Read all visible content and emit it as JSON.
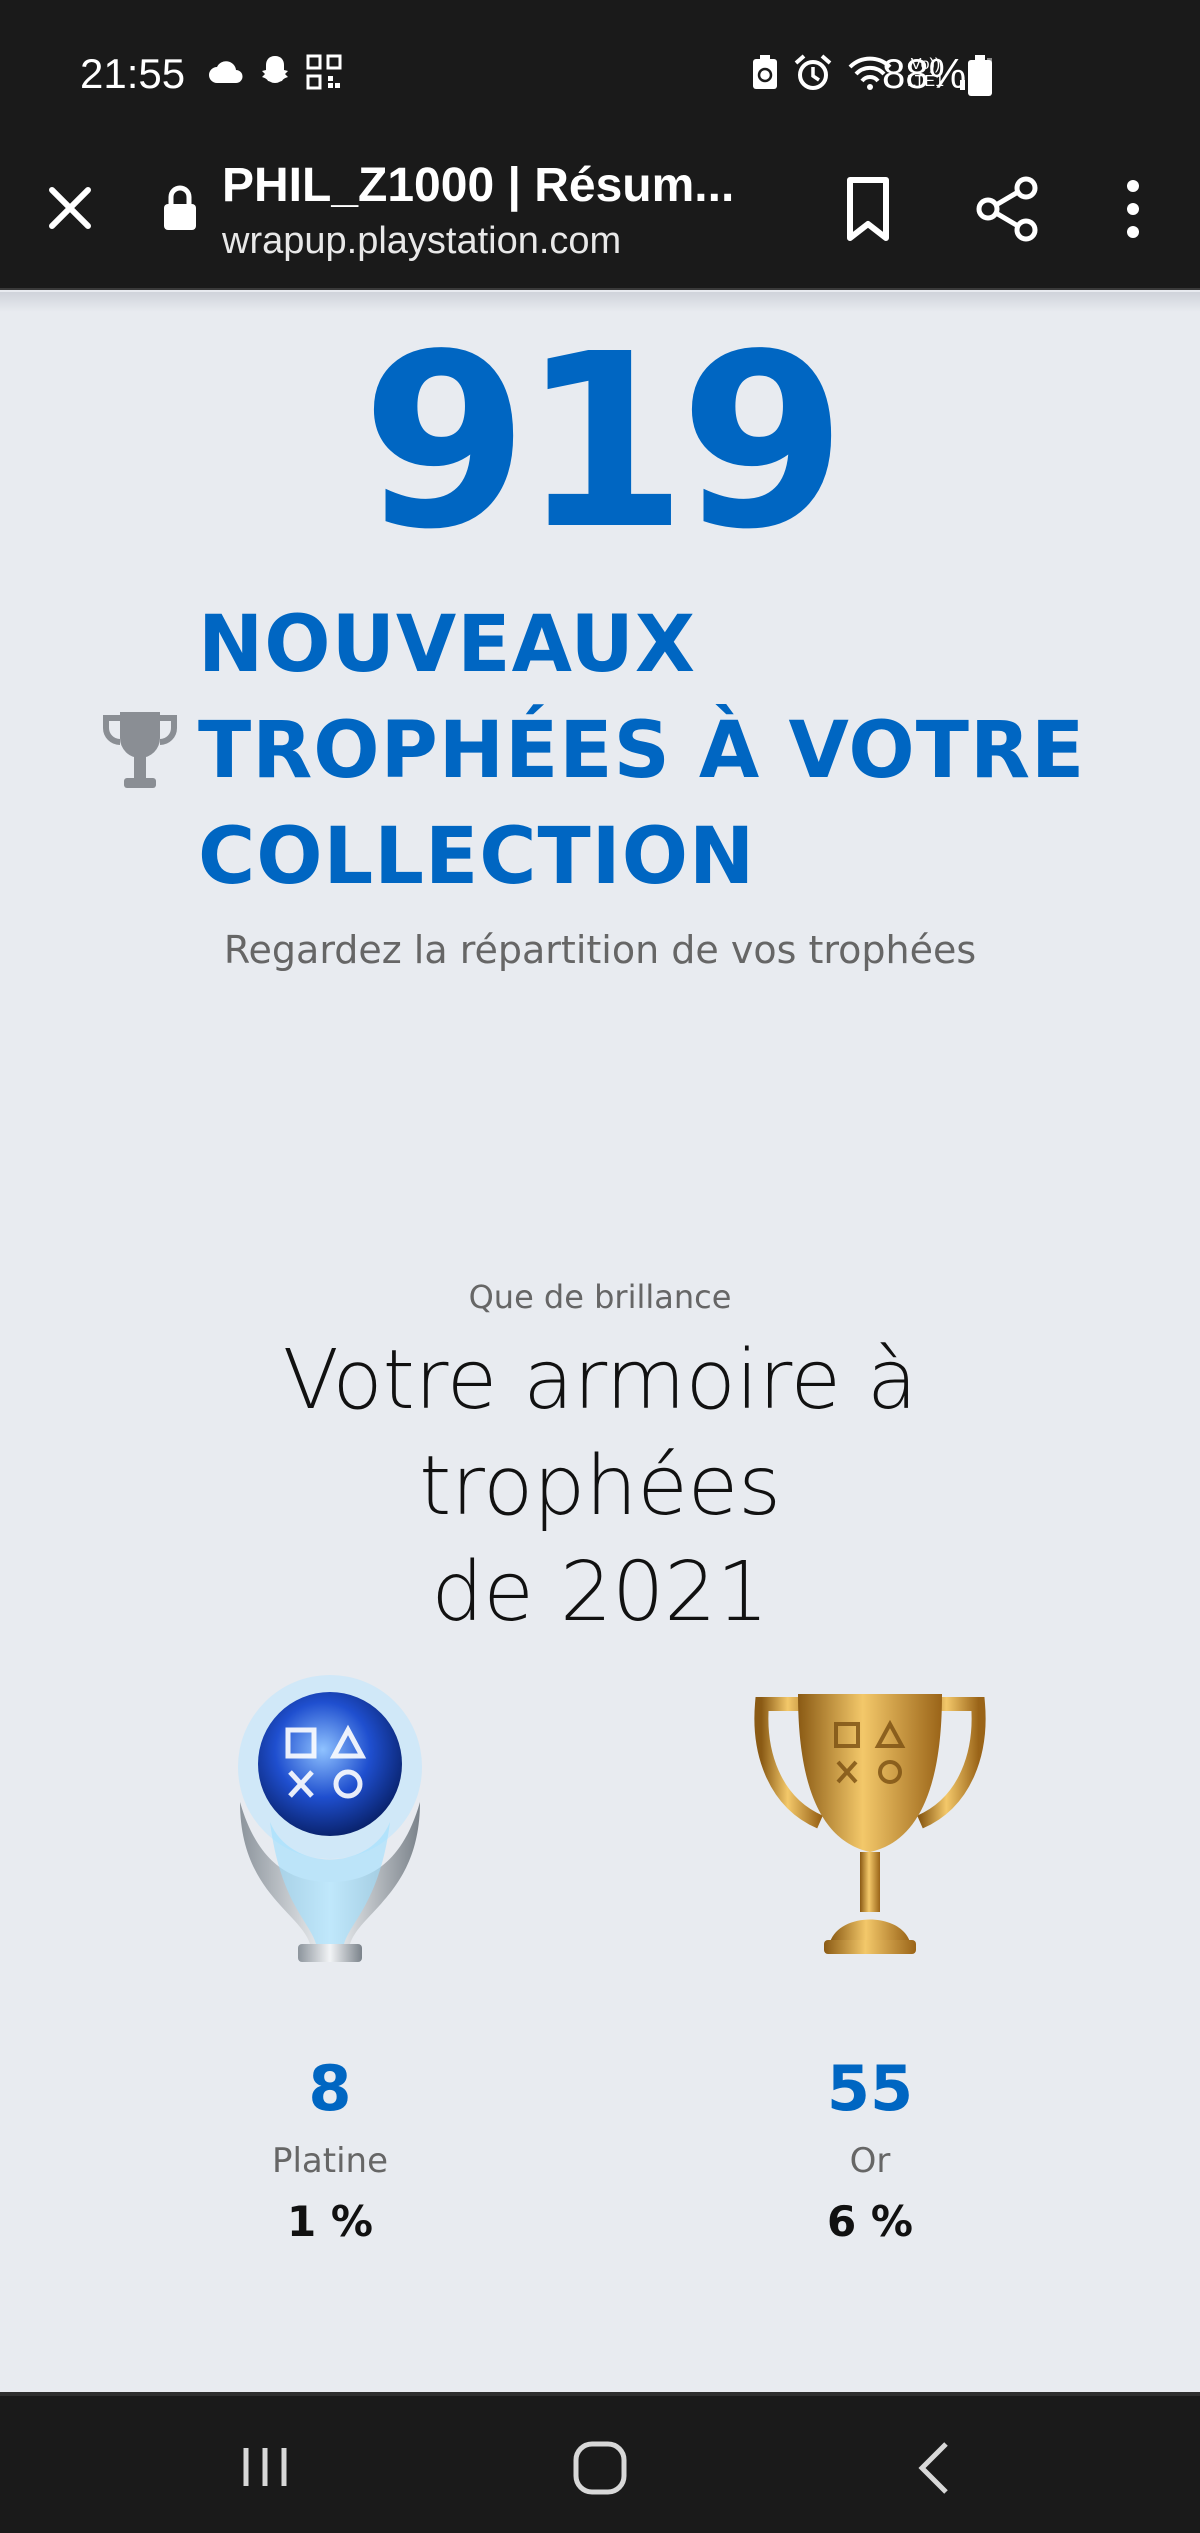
{
  "status_bar": {
    "time": "21:55",
    "battery": "88%",
    "network": "LTE1",
    "icons_left": [
      "cloud-icon",
      "snapchat-icon",
      "qr-icon"
    ],
    "icons_right": [
      "battery-saver-icon",
      "alarm-icon",
      "wifi-icon",
      "volte-icon",
      "signal-icon"
    ]
  },
  "browser": {
    "page_title": "PHIL_Z1000 | Résum...",
    "domain": "wrapup.playstation.com",
    "icons": [
      "close-icon",
      "lock-icon",
      "bookmark-icon",
      "share-icon",
      "more-vert-icon"
    ]
  },
  "hero": {
    "count": "919",
    "headline_lines": [
      "NOUVEAUX",
      "TROPHÉES À VOTRE",
      "COLLECTION"
    ],
    "subtitle": "Regardez la répartition de vos trophées"
  },
  "cabinet": {
    "eyebrow": "Que de brillance",
    "title_line1": "Votre armoire à trophées",
    "title_line2": "de 2021",
    "trophies": [
      {
        "type": "platinum",
        "count": "8",
        "label": "Platine",
        "percent": "1 %"
      },
      {
        "type": "gold",
        "count": "55",
        "label": "Or",
        "percent": "6 %"
      }
    ]
  },
  "colors": {
    "accent": "#0066c2",
    "background": "#e8ebf0",
    "chrome": "#1a1a1a"
  }
}
